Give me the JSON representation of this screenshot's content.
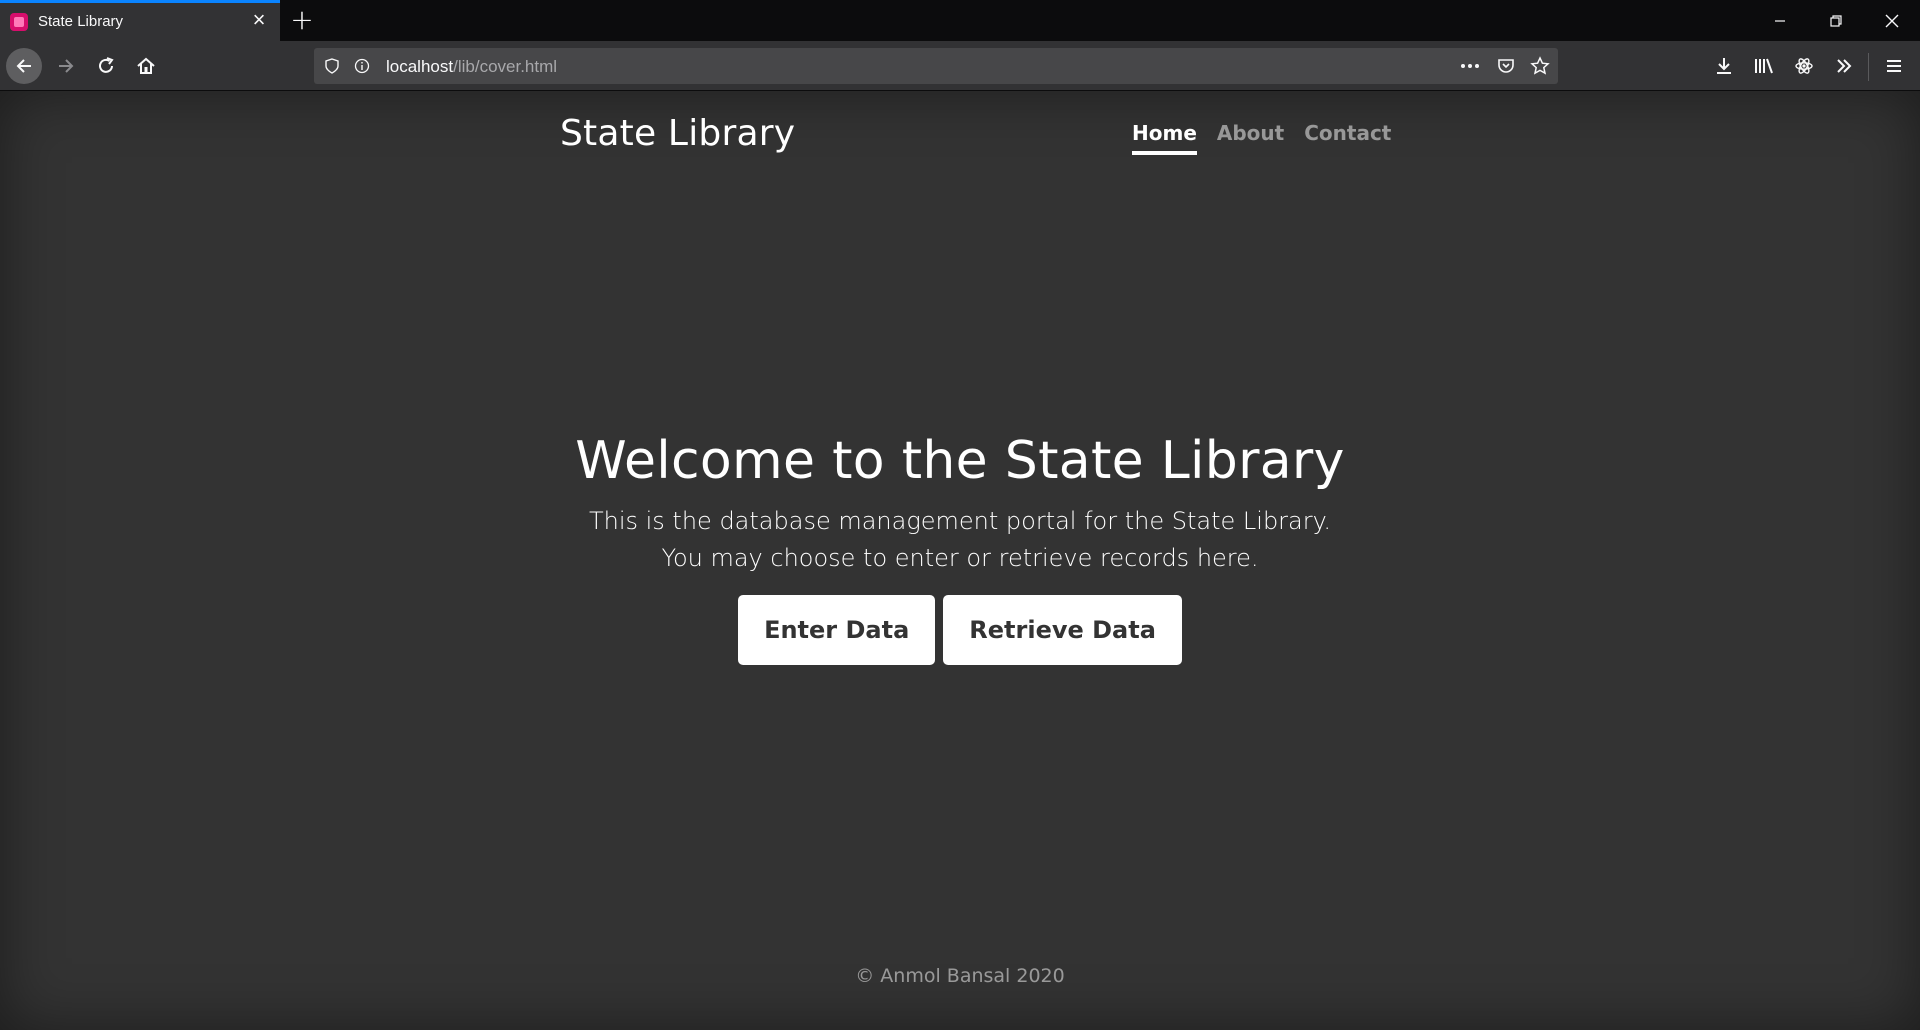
{
  "browser": {
    "tab_title": "State Library",
    "url_host": "localhost",
    "url_path": "/lib/cover.html",
    "accent_color": "#0a84ff"
  },
  "icons": {
    "back": "arrow-left-icon",
    "forward": "arrow-right-icon",
    "reload": "reload-icon",
    "home": "home-icon",
    "tracking": "shield-icon",
    "info": "info-icon",
    "page_actions": "ellipsis-icon",
    "pocket": "pocket-icon",
    "bookmark": "star-icon",
    "downloads": "download-icon",
    "library": "library-icon",
    "extension": "atom-icon",
    "overflow": "chevron-double-right-icon",
    "menu": "hamburger-icon"
  },
  "site": {
    "brand": "State Library",
    "nav": [
      {
        "label": "Home",
        "active": true
      },
      {
        "label": "About",
        "active": false
      },
      {
        "label": "Contact",
        "active": false
      }
    ],
    "hero": {
      "title": "Welcome to the State Library",
      "lead": "This is the database management portal for the State Library. You may choose to enter or retrieve records here.",
      "enter_label": "Enter Data",
      "retrieve_label": "Retrieve Data"
    },
    "footer": "© Anmol Bansal 2020",
    "background_color": "#333333"
  }
}
